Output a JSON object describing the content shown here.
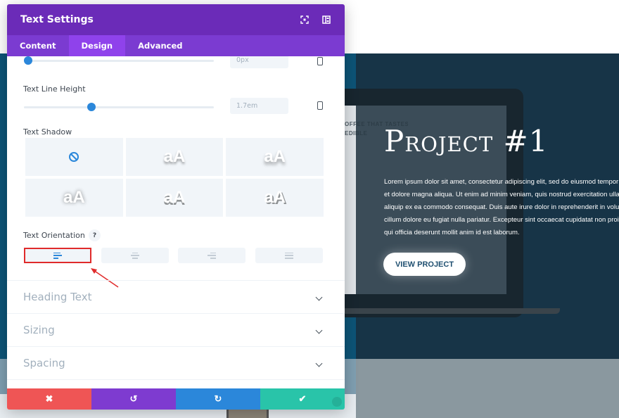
{
  "modal": {
    "title": "Text Settings",
    "header_icons": [
      "expand-icon",
      "split-view-icon"
    ],
    "tabs": [
      {
        "label": "Content",
        "active": false
      },
      {
        "label": "Design",
        "active": true
      },
      {
        "label": "Advanced",
        "active": false
      }
    ],
    "partial_slider": {
      "value": "0px",
      "placeholder": "0px",
      "fraction": 0.0
    },
    "line_height": {
      "label": "Text Line Height",
      "value": "1.7em",
      "fraction": 0.35
    },
    "text_shadow": {
      "label": "Text Shadow",
      "none_icon": "no-shadow-icon",
      "options": [
        "aA",
        "aA",
        "aA",
        "aA",
        "aA"
      ],
      "selected": 0
    },
    "text_orientation": {
      "label": "Text Orientation",
      "help": "?",
      "options": [
        "align-left-icon",
        "align-center-icon",
        "align-right-icon",
        "align-justify-icon"
      ],
      "selected": 0
    },
    "sections": [
      {
        "label": "Heading Text"
      },
      {
        "label": "Sizing"
      },
      {
        "label": "Spacing"
      }
    ],
    "footer": {
      "cancel_icon": "✖",
      "undo_icon": "↺",
      "redo_icon": "↻",
      "save_icon": "✔"
    }
  },
  "page": {
    "coffee_heading_line1": "OFFEE THAT TASTES",
    "coffee_heading_line2": "EDIBLE",
    "hero_title": "Project #1",
    "hero_body": [
      "Lorem ipsum dolor sit amet, consectetur adipiscing elit, sed do eiusmod tempor incididunt ut labore",
      "et dolore magna aliqua. Ut enim ad minim veniam, quis nostrud exercitation ullamco laboris nisi ut",
      "aliquip ex ea commodo consequat. Duis aute irure dolor in reprehenderit in voluptate velit esse",
      "cillum dolore eu fugiat nulla pariatur. Excepteur sint occaecat cupidatat non proident, sunt in culpa",
      "qui officia deserunt mollit anim id est laborum."
    ],
    "cta_label": "VIEW PROJECT"
  },
  "colors": {
    "header": "#6b2bb8",
    "tabs": "#7b3bd1",
    "tab_active": "#8f42eb",
    "accent": "#2b87da",
    "cancel": "#ef5555",
    "undo": "#7e3bd0",
    "redo": "#2b87da",
    "save": "#29c4a9",
    "highlight": "#e02b2b"
  }
}
